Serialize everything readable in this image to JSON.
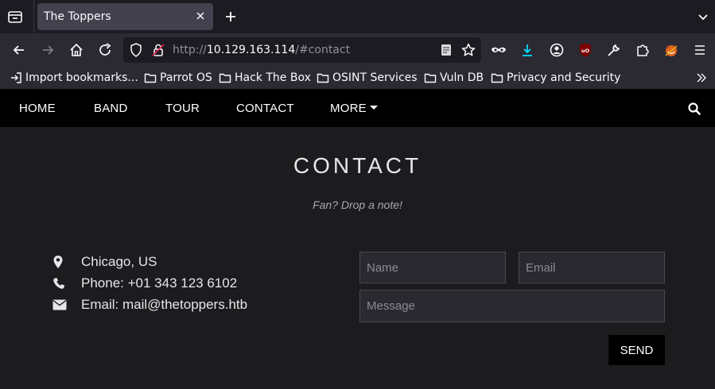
{
  "browser": {
    "tab_title": "The Toppers",
    "url_scheme": "http://",
    "url_host": "10.129.163.114",
    "url_path": "/#contact",
    "bookmarks": [
      {
        "label": "Import bookmarks..."
      },
      {
        "label": "Parrot OS"
      },
      {
        "label": "Hack The Box"
      },
      {
        "label": "OSINT Services"
      },
      {
        "label": "Vuln DB"
      },
      {
        "label": "Privacy and Security"
      }
    ]
  },
  "site_nav": {
    "items": [
      {
        "label": "HOME"
      },
      {
        "label": "BAND"
      },
      {
        "label": "TOUR"
      },
      {
        "label": "CONTACT"
      },
      {
        "label": "MORE"
      }
    ]
  },
  "contact": {
    "heading": "CONTACT",
    "tagline": "Fan? Drop a note!",
    "location": "Chicago, US",
    "phone": "Phone: +01 343 123 6102",
    "email": "Email: mail@thetoppers.htb",
    "form": {
      "name_placeholder": "Name",
      "email_placeholder": "Email",
      "message_placeholder": "Message",
      "send_label": "SEND"
    }
  },
  "colors": {
    "nav_bg": "#000000",
    "content_bg": "#1c1b1e",
    "text": "#e6e6e8"
  }
}
